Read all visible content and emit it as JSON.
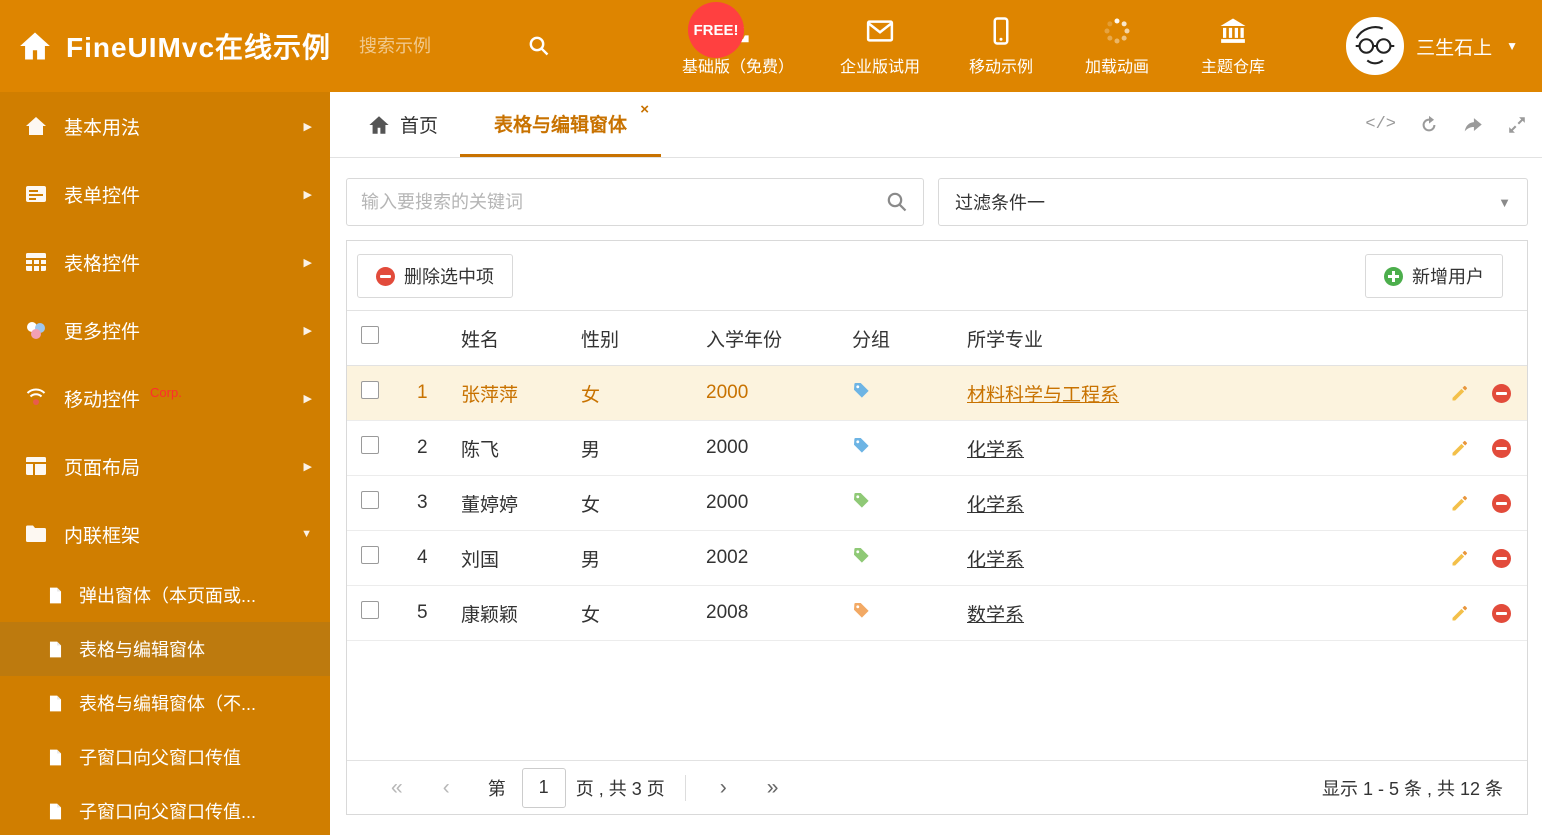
{
  "icons": {
    "close": "×",
    "caret_down": "▼",
    "chevron_right": "▶",
    "code": "</>",
    "first": "«",
    "prev": "‹",
    "next": "›",
    "last": "»"
  },
  "header": {
    "title": "FineUIMvc在线示例",
    "search_placeholder": "搜索示例",
    "free_badge": "FREE!",
    "nav_items": [
      {
        "label": "基础版（免费）",
        "icon": "download-icon"
      },
      {
        "label": "企业版试用",
        "icon": "envelope-icon"
      },
      {
        "label": "移动示例",
        "icon": "mobile-icon"
      },
      {
        "label": "加载动画",
        "icon": "spinner-icon"
      },
      {
        "label": "主题仓库",
        "icon": "bank-icon"
      }
    ],
    "user_name": "三生石上"
  },
  "sidebar": {
    "items": [
      {
        "label": "基本用法"
      },
      {
        "label": "表单控件"
      },
      {
        "label": "表格控件"
      },
      {
        "label": "更多控件"
      },
      {
        "label": "移动控件",
        "badge": "Corp."
      },
      {
        "label": "页面布局"
      },
      {
        "label": "内联框架"
      }
    ],
    "subitems": [
      {
        "label": "弹出窗体（本页面或..."
      },
      {
        "label": "表格与编辑窗体"
      },
      {
        "label": "表格与编辑窗体（不..."
      },
      {
        "label": "子窗口向父窗口传值"
      },
      {
        "label": "子窗口向父窗口传值..."
      }
    ]
  },
  "tabs": [
    {
      "label": "首页"
    },
    {
      "label": "表格与编辑窗体"
    }
  ],
  "filter": {
    "search_placeholder": "输入要搜索的关键词",
    "dropdown_value": "过滤条件一"
  },
  "toolbar": {
    "delete_label": "删除选中项",
    "add_label": "新增用户"
  },
  "table": {
    "columns": [
      "姓名",
      "性别",
      "入学年份",
      "分组",
      "所学专业"
    ],
    "rows": [
      {
        "num": "1",
        "name": "张萍萍",
        "gender": "女",
        "year": "2000",
        "tag_color": "#6db4e4",
        "major": "材料科学与工程系"
      },
      {
        "num": "2",
        "name": "陈飞",
        "gender": "男",
        "year": "2000",
        "tag_color": "#6db4e4",
        "major": "化学系"
      },
      {
        "num": "3",
        "name": "董婷婷",
        "gender": "女",
        "year": "2000",
        "tag_color": "#8fc976",
        "major": "化学系"
      },
      {
        "num": "4",
        "name": "刘国",
        "gender": "男",
        "year": "2002",
        "tag_color": "#8fc976",
        "major": "化学系"
      },
      {
        "num": "5",
        "name": "康颖颖",
        "gender": "女",
        "year": "2008",
        "tag_color": "#f2a964",
        "major": "数学系"
      }
    ]
  },
  "pagination": {
    "prefix": "第",
    "current_page": "1",
    "suffix": "页 , 共 3 页",
    "summary": "显示 1 - 5 条 , 共 12 条"
  }
}
